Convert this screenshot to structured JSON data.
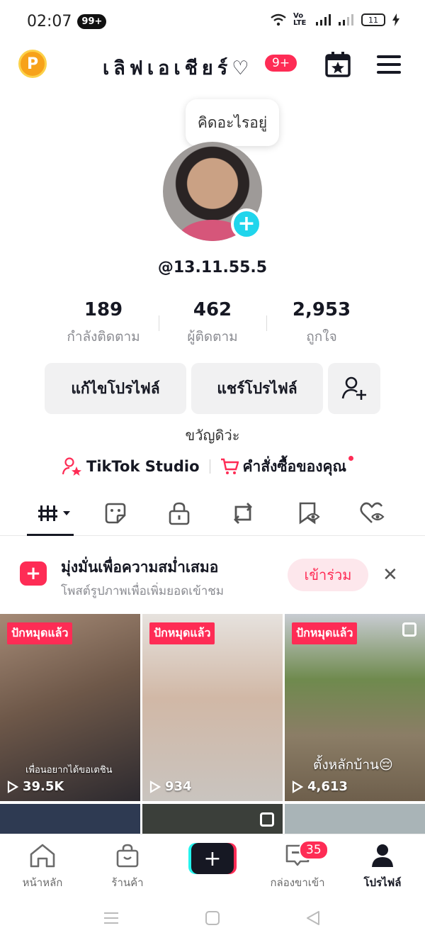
{
  "status_bar": {
    "time": "02:07",
    "notif_badge": "99+",
    "network": "Vo LTE",
    "battery": "11"
  },
  "header": {
    "coin_label": "P",
    "title": "เลิฟเอเชียร์♡",
    "notif_count": "9+",
    "icons": [
      "coin-icon",
      "calendar-star-icon",
      "menu-icon"
    ]
  },
  "profile": {
    "note": "คิดอะไรอยู่",
    "handle": "@13.11.55.5",
    "stats": [
      {
        "value": "189",
        "label": "กำลังติดตาม"
      },
      {
        "value": "462",
        "label": "ผู้ติดตาม"
      },
      {
        "value": "2,953",
        "label": "ถูกใจ"
      }
    ],
    "edit_button": "แก้ไขโปรไฟล์",
    "share_button": "แชร์โปรไฟล์",
    "bio": "ขวัญดิว่ะ",
    "studio_link": "TikTok Studio",
    "orders_link": "คำสั่งซื้อของคุณ"
  },
  "tabs": [
    "videos-grid-icon",
    "sticker-icon",
    "lock-icon",
    "repost-icon",
    "bookmark-icon",
    "liked-icon"
  ],
  "promo": {
    "title": "มุ่งมั่นเพื่อความสม่ำเสมอ",
    "subtitle": "โพสต์รูปภาพเพื่อเพิ่มยอดเข้าชม",
    "join_button": "เข้าร่วม"
  },
  "videos": [
    {
      "pinned": "ปักหมุดแล้ว",
      "views": "39.5K",
      "caption": "เพื่อนอยากได้ขอเตชิน",
      "bg": "#7a6a5e"
    },
    {
      "pinned": "ปักหมุดแล้ว",
      "views": "934",
      "caption": "",
      "bg": "#d9d4cf"
    },
    {
      "pinned": "ปักหมุดแล้ว",
      "views": "4,613",
      "caption": "ตั้งหลักบ้าน😔",
      "bg": "#8a8f6e"
    }
  ],
  "bottom_nav": {
    "home": "หน้าหลัก",
    "shop": "ร้านค้า",
    "inbox": "กล่องขาเข้า",
    "inbox_count": "35",
    "profile": "โปรไฟล์"
  },
  "colors": {
    "accent": "#fe2c55",
    "cyan": "#25f4ee",
    "text": "#161823",
    "muted": "#8a8b91"
  }
}
